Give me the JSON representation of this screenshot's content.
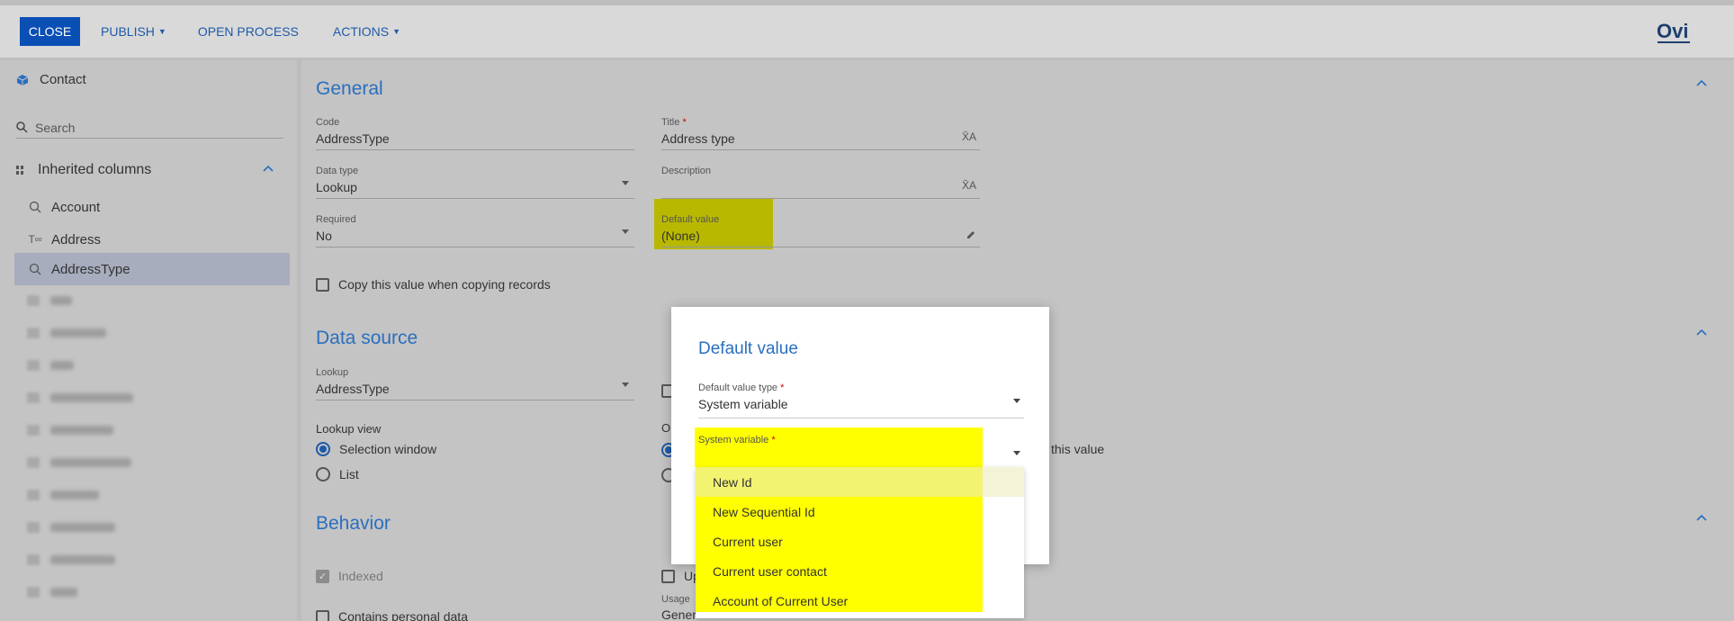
{
  "toolbar": {
    "close_label": "CLOSE",
    "publish_label": "PUBLISH",
    "open_process_label": "OPEN PROCESS",
    "actions_label": "ACTIONS",
    "logo_text": "Ovi"
  },
  "sidebar": {
    "object_name": "Contact",
    "search_placeholder": "Search",
    "group_label": "Inherited columns",
    "items": [
      {
        "label": "Account",
        "icon": "lookup-icon"
      },
      {
        "label": "Address",
        "icon": "text-icon"
      },
      {
        "label": "AddressType",
        "icon": "lookup-icon",
        "active": true
      }
    ]
  },
  "general": {
    "title": "General",
    "code_label": "Code",
    "code_value": "AddressType",
    "title_label": "Title",
    "title_value": "Address type",
    "data_type_label": "Data type",
    "data_type_value": "Lookup",
    "description_label": "Description",
    "description_value": "",
    "required_label": "Required",
    "required_value": "No",
    "default_label": "Default value",
    "default_value": "(None)",
    "copy_label": "Copy this value when copying records"
  },
  "data_source": {
    "title": "Data source",
    "lookup_label": "Lookup",
    "lookup_value": "AddressType",
    "lookup_view_label": "Lookup view",
    "opt_selection": "Selection window",
    "opt_list": "List",
    "partial_o": "O",
    "partial_this_value": "this value"
  },
  "behavior": {
    "title": "Behavior",
    "indexed_label": "Indexed",
    "personal_label": "Contains personal data",
    "partial_up": "Up",
    "usage_partial": "Usage",
    "usage_value_partial": "Gener"
  },
  "modal": {
    "title": "Default value",
    "type_label": "Default value type",
    "type_value": "System variable",
    "sysvar_label": "System variable",
    "options": [
      "New Id",
      "New Sequential Id",
      "Current user",
      "Current user contact",
      "Account of Current User"
    ]
  },
  "colors": {
    "accent": "#2a6fbf",
    "close_button": "#0a4fb4",
    "highlight": "#ffff00"
  }
}
